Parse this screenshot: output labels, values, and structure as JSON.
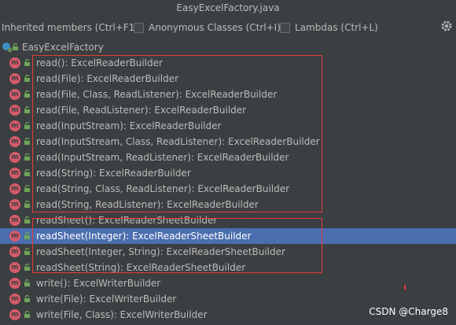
{
  "window": {
    "title": "EasyExcelFactory.java"
  },
  "toolbar": {
    "inherited_label": "Inherited members (Ctrl+F12)",
    "anonymous_label": "Anonymous Classes (Ctrl+I)",
    "lambdas_label": "Lambdas (Ctrl+L)",
    "settings_icon": "gear-icon"
  },
  "tree": {
    "class_name": "EasyExcelFactory",
    "members": [
      {
        "label": "read(): ExcelReaderBuilder"
      },
      {
        "label": "read(File): ExcelReaderBuilder"
      },
      {
        "label": "read(File, Class, ReadListener): ExcelReaderBuilder"
      },
      {
        "label": "read(File, ReadListener): ExcelReaderBuilder"
      },
      {
        "label": "read(InputStream): ExcelReaderBuilder"
      },
      {
        "label": "read(InputStream, Class, ReadListener): ExcelReaderBuilder"
      },
      {
        "label": "read(InputStream, ReadListener): ExcelReaderBuilder"
      },
      {
        "label": "read(String): ExcelReaderBuilder"
      },
      {
        "label": "read(String, Class, ReadListener): ExcelReaderBuilder"
      },
      {
        "label": "read(String, ReadListener): ExcelReaderBuilder"
      },
      {
        "label": "readSheet(): ExcelReaderSheetBuilder"
      },
      {
        "label": "readSheet(Integer): ExcelReaderSheetBuilder",
        "selected": true
      },
      {
        "label": "readSheet(Integer, String): ExcelReaderSheetBuilder"
      },
      {
        "label": "readSheet(String): ExcelReaderSheetBuilder"
      },
      {
        "label": "write(): ExcelWriterBuilder"
      },
      {
        "label": "write(File): ExcelWriterBuilder"
      },
      {
        "label": "write(File, Class): ExcelWriterBuilder"
      }
    ]
  },
  "watermark": "CSDN @Charge8",
  "colors": {
    "background": "#3c3f41",
    "selection": "#4b6eaf",
    "method_icon": "#d55b6b",
    "highlight_box": "#e33b3b"
  }
}
